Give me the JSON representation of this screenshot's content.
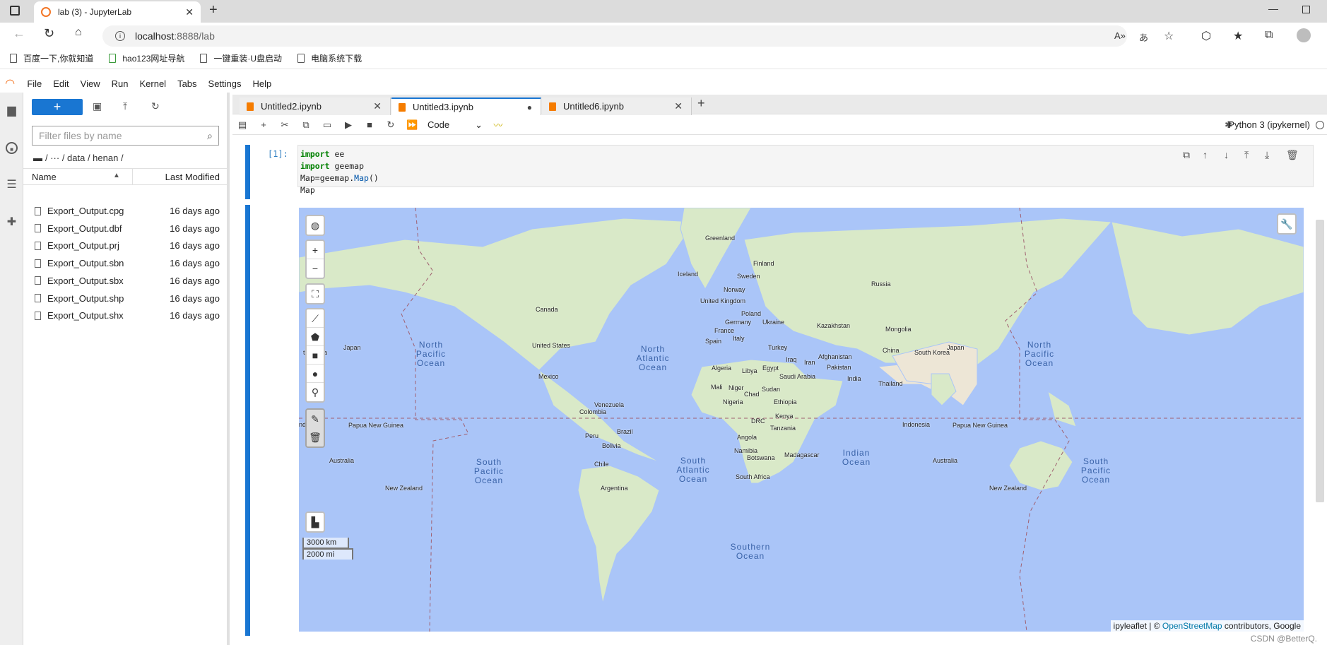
{
  "browser": {
    "tab_title": "lab (3) - JupyterLab",
    "url_host": "localhost",
    "url_rest": ":8888/lab",
    "bookmarks": [
      "百度一下,你就知道",
      "hao123网址导航",
      "一键重装·U盘启动",
      "电脑系统下载"
    ]
  },
  "menu": [
    "File",
    "Edit",
    "View",
    "Run",
    "Kernel",
    "Tabs",
    "Settings",
    "Help"
  ],
  "filebrowser": {
    "filter_placeholder": "Filter files by name",
    "breadcrumb": "/  ···  / data / henan /",
    "col_name": "Name",
    "col_modified": "Last Modified",
    "files": [
      {
        "name": "Export_Output.cpg",
        "modified": "16 days ago"
      },
      {
        "name": "Export_Output.dbf",
        "modified": "16 days ago"
      },
      {
        "name": "Export_Output.prj",
        "modified": "16 days ago"
      },
      {
        "name": "Export_Output.sbn",
        "modified": "16 days ago"
      },
      {
        "name": "Export_Output.sbx",
        "modified": "16 days ago"
      },
      {
        "name": "Export_Output.shp",
        "modified": "16 days ago"
      },
      {
        "name": "Export_Output.shx",
        "modified": "16 days ago"
      }
    ]
  },
  "tabs": [
    "Untitled2.ipynb",
    "Untitled3.ipynb",
    "Untitled6.ipynb"
  ],
  "notebook": {
    "cell_type": "Code",
    "kernel": "Python 3 (ipykernel)",
    "prompt": "[1]:",
    "code": [
      "import ee",
      "import geemap",
      "Map=geemap.Map()",
      "Map"
    ]
  },
  "map": {
    "scale_km": "3000 km",
    "scale_mi": "2000 mi",
    "attribution_prefix": "ipyleaflet | © ",
    "attribution_link": "OpenStreetMap",
    "attribution_suffix": " contributors, Google",
    "labels": {
      "greenland": "Greenland",
      "iceland": "Iceland",
      "finland": "Finland",
      "sweden": "Sweden",
      "norway": "Norway",
      "russia": "Russia",
      "uk": "United Kingdom",
      "poland": "Poland",
      "germany": "Germany",
      "ukraine": "Ukraine",
      "france": "France",
      "italy": "Italy",
      "spain": "Spain",
      "turkey": "Turkey",
      "kazakhstan": "Kazakhstan",
      "mongolia": "Mongolia",
      "china": "China",
      "japan": "Japan",
      "skorea": "South Korea",
      "japan_w": "Japan",
      "nkorea_w": "th Korea",
      "canada": "Canada",
      "us": "United States",
      "mexico": "Mexico",
      "iraq": "Iraq",
      "iran": "Iran",
      "afghanistan": "Afghanistan",
      "pakistan": "Pakistan",
      "india": "India",
      "thailand": "Thailand",
      "algeria": "Algeria",
      "libya": "Libya",
      "egypt": "Egypt",
      "saudi": "Saudi Arabia",
      "mali": "Mali",
      "niger": "Niger",
      "chad": "Chad",
      "sudan": "Sudan",
      "nigeria": "Nigeria",
      "ethiopia": "Ethiopia",
      "kenya": "Kenya",
      "drc": "DRC",
      "tanzania": "Tanzania",
      "angola": "Angola",
      "namibia": "Namibia",
      "botswana": "Botswana",
      "madagascar": "Madagascar",
      "southafrica": "South Africa",
      "venezuela": "Venezuela",
      "colombia": "Colombia",
      "peru": "Peru",
      "brazil": "Brazil",
      "bolivia": "Bolivia",
      "chile": "Chile",
      "argentina": "Argentina",
      "indonesia": "Indonesia",
      "png": "Papua New Guinea",
      "png_w": "Papua New Guinea",
      "australia": "Australia",
      "australia_w": "Australia",
      "nz": "New Zealand",
      "nz_w": "New Zealand",
      "india_w": "ndo"
    },
    "oceans": {
      "npac_w": "North Pacific Ocean",
      "natl": "North Atlantic Ocean",
      "npac_e": "North Pacific Ocean",
      "spac_w": "South Pacific Ocean",
      "satl": "South Atlantic Ocean",
      "indian": "Indian Ocean",
      "spac_e": "South Pacific Ocean",
      "southern": "Southern Ocean"
    }
  },
  "watermark": "CSDN @BetterQ."
}
